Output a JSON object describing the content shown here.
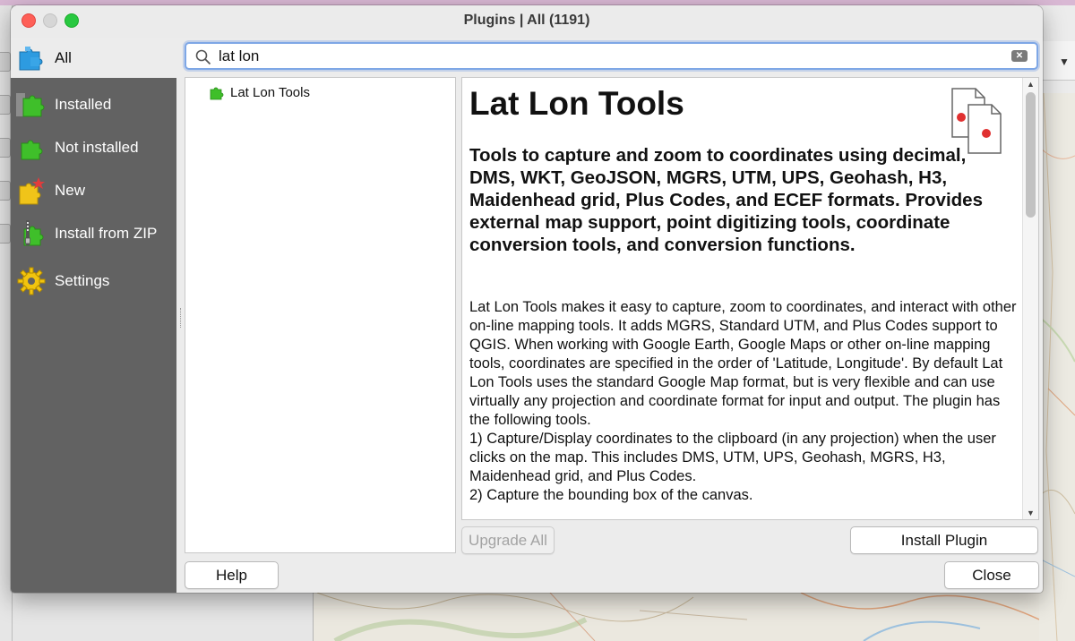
{
  "window": {
    "title": "Plugins | All (1191)"
  },
  "sidebar": {
    "items": [
      {
        "label": "All",
        "icon": "puzzle-all-icon"
      },
      {
        "label": "Installed",
        "icon": "puzzle-installed-icon"
      },
      {
        "label": "Not installed",
        "icon": "puzzle-not-installed-icon"
      },
      {
        "label": "New",
        "icon": "puzzle-new-icon"
      },
      {
        "label": "Install from ZIP",
        "icon": "puzzle-zip-icon"
      },
      {
        "label": "Settings",
        "icon": "gear-icon"
      }
    ],
    "selected": "All"
  },
  "search": {
    "value": "lat lon"
  },
  "plugin_list": {
    "items": [
      {
        "label": "Lat Lon Tools"
      }
    ]
  },
  "details": {
    "title": "Lat Lon Tools",
    "summary": "Tools to capture and zoom to coordinates using decimal, DMS, WKT, GeoJSON, MGRS, UTM, UPS, Geohash, H3, Maidenhead grid, Plus Codes, and ECEF formats. Provides external map support, point digitizing tools, coordinate conversion tools, and conversion functions.",
    "description": "Lat Lon Tools makes it easy to capture, zoom to coordinates, and interact with other on-line mapping tools. It adds MGRS, Standard UTM, and Plus Codes support to QGIS. When working with Google Earth, Google Maps or other on-line mapping tools, coordinates are specified in the order of 'Latitude, Longitude'. By default Lat Lon Tools uses the standard Google Map format, but is very flexible and can use virtually any projection and coordinate format for input and output. The plugin has the following tools.\n1) Capture/Display coordinates to the clipboard (in any projection) when the user clicks on the map. This includes DMS, UTM, UPS, Geohash, MGRS, H3, Maidenhead grid, and Plus Codes.\n2) Capture the bounding box of the canvas."
  },
  "buttons": {
    "upgrade_all": "Upgrade All",
    "install_plugin": "Install Plugin",
    "help": "Help",
    "close": "Close"
  },
  "colors": {
    "sidebar_bg": "#626262",
    "selected_bg": "#ececec",
    "puzzle_green": "#3fbf2a",
    "focus_ring": "#7ea7e6",
    "traffic_red": "#fe5f57",
    "traffic_green": "#28c840"
  }
}
